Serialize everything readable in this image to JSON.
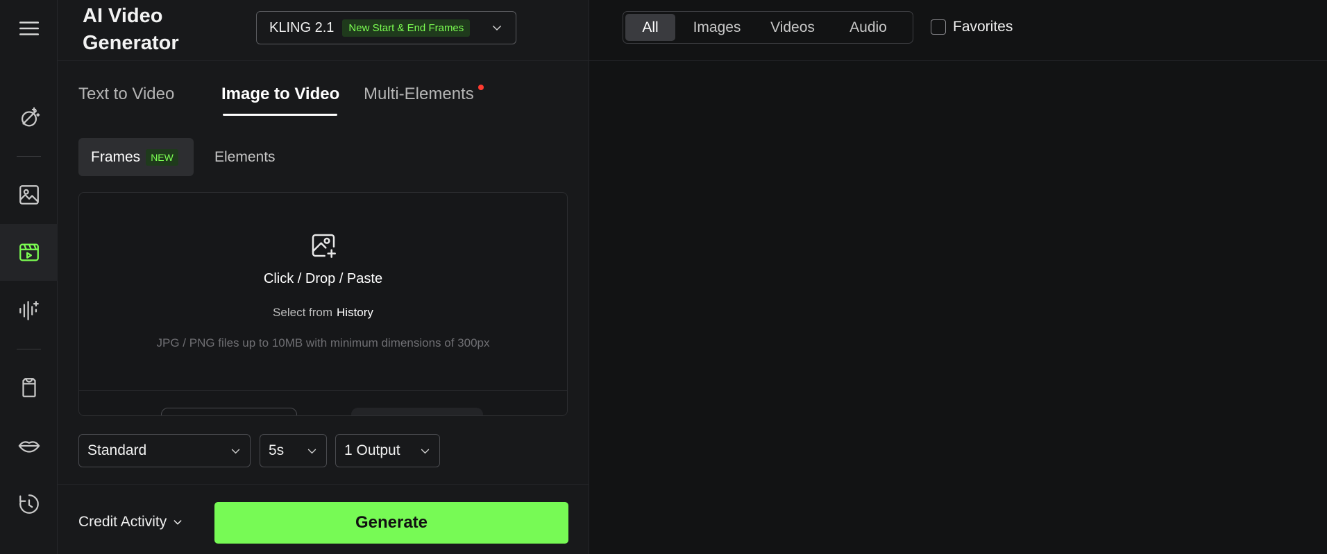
{
  "app": {
    "title": "AI Video Generator"
  },
  "model": {
    "name": "KLING 2.1",
    "badge": "New Start & End Frames"
  },
  "mode_tabs": [
    {
      "label": "Text to Video",
      "active": false
    },
    {
      "label": "Image to Video",
      "active": true
    },
    {
      "label": "Multi-Elements",
      "active": false,
      "has_dot": true
    }
  ],
  "sub_tabs": [
    {
      "label": "Frames",
      "badge": "NEW",
      "active": true
    },
    {
      "label": "Elements",
      "active": false
    }
  ],
  "upload": {
    "title": "Click / Drop / Paste",
    "select_from": "Select from",
    "history": "History",
    "hint": "JPG / PNG files up to 10MB with minimum dimensions of 300px"
  },
  "options": {
    "quality": "Standard",
    "duration": "5s",
    "outputs": "1 Output"
  },
  "footer": {
    "credit": "Credit Activity",
    "generate": "Generate"
  },
  "filters": [
    {
      "label": "All",
      "active": true
    },
    {
      "label": "Images",
      "active": false
    },
    {
      "label": "Videos",
      "active": false
    },
    {
      "label": "Audio",
      "active": false
    }
  ],
  "favorites": {
    "label": "Favorites",
    "checked": false
  },
  "rail_icons": [
    "menu-icon",
    "magic-wand-icon",
    "image-icon",
    "video-icon",
    "audio-wave-icon",
    "shirt-icon",
    "lips-icon",
    "history-icon"
  ],
  "colors": {
    "accent": "#77fa55",
    "background": "#111213",
    "panel": "#18191b",
    "dot": "#ff3b30"
  }
}
